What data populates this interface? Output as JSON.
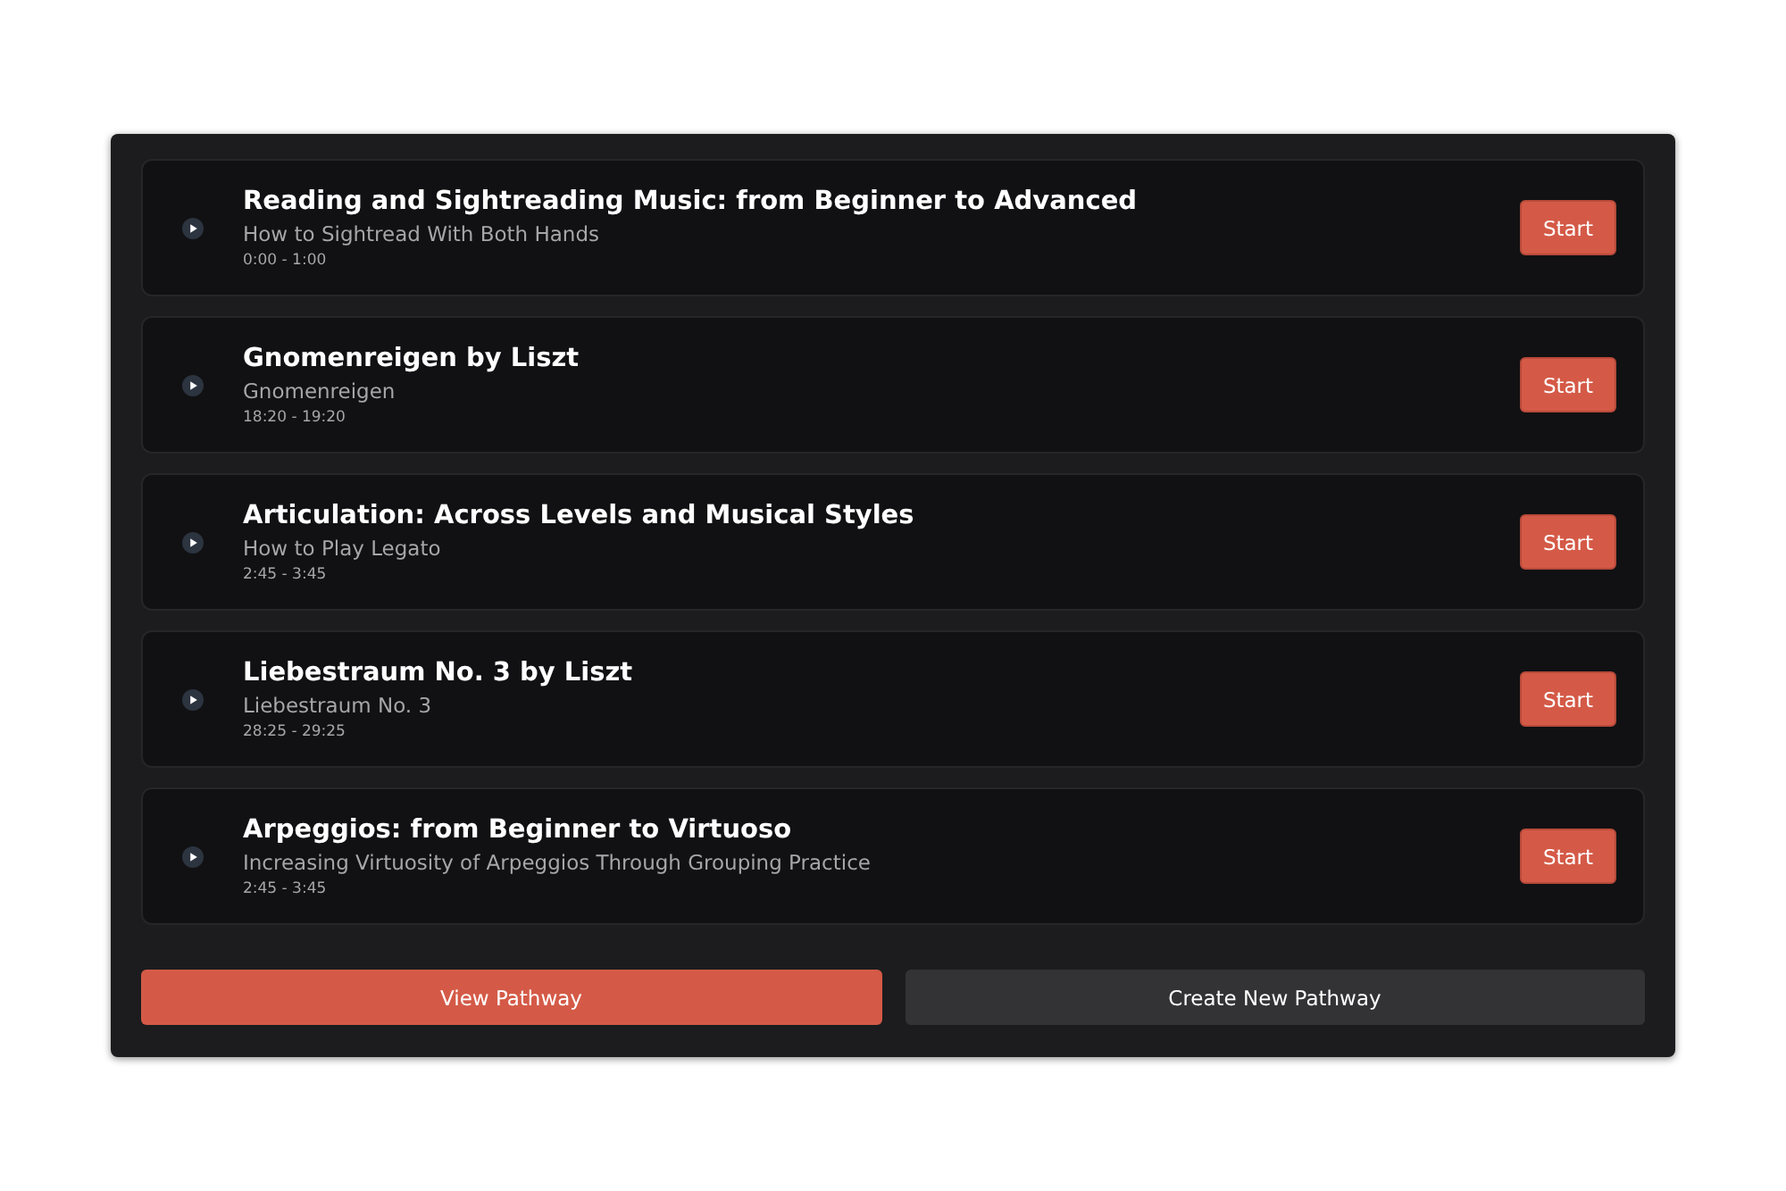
{
  "lessons": [
    {
      "title": "Reading and Sightreading Music: from Beginner to Advanced",
      "subtitle": "How to Sightread With Both Hands",
      "time": "0:00 - 1:00",
      "action": "Start"
    },
    {
      "title": "Gnomenreigen by Liszt",
      "subtitle": "Gnomenreigen",
      "time": "18:20 - 19:20",
      "action": "Start"
    },
    {
      "title": "Articulation: Across Levels and Musical Styles",
      "subtitle": "How to Play Legato",
      "time": "2:45 - 3:45",
      "action": "Start"
    },
    {
      "title": "Liebestraum No. 3 by Liszt",
      "subtitle": "Liebestraum No. 3",
      "time": "28:25 - 29:25",
      "action": "Start"
    },
    {
      "title": "Arpeggios: from Beginner to Virtuoso",
      "subtitle": "Increasing Virtuosity of Arpeggios Through Grouping Practice",
      "time": "2:45 - 3:45",
      "action": "Start"
    }
  ],
  "buttons": [
    {
      "label": "View Pathway",
      "kind": "primary"
    },
    {
      "label": "Create New Pathway",
      "kind": "secondary"
    }
  ]
}
